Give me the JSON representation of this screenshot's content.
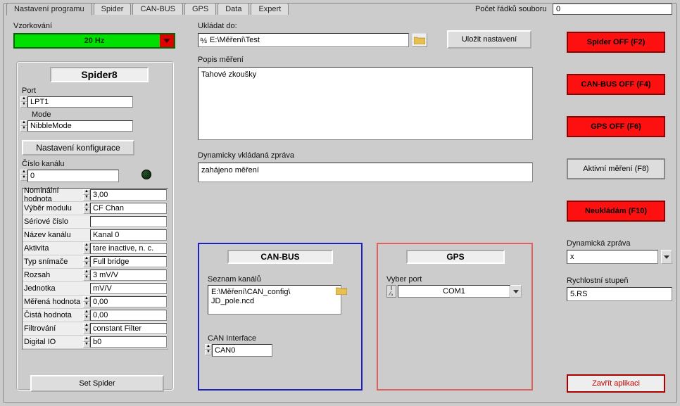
{
  "tabs": [
    "Nastavení programu",
    "Spider",
    "CAN-BUS",
    "GPS",
    "Data",
    "Expert"
  ],
  "active_tab_index": 0,
  "row_count_label": "Počet řádků souboru",
  "row_count_value": "0",
  "vzork": {
    "label": "Vzorkování",
    "value": "20 Hz"
  },
  "spider": {
    "title": "Spider8",
    "port_label": "Port",
    "port_value": "LPT1",
    "mode_label": "Mode",
    "mode_value": "NibbleMode",
    "config_btn": "Nastavení konfigurace",
    "channel_num_label": "Číslo kanálu",
    "channel_num_value": "0",
    "rows": [
      {
        "label": "Nominální hodnota",
        "value": "3,00",
        "spin": true
      },
      {
        "label": "Výběr modulu",
        "value": "CF Chan",
        "spin": true
      },
      {
        "label": "Sériové číslo",
        "value": "",
        "spin": false
      },
      {
        "label": "Název kanálu",
        "value": "Kanal 0",
        "spin": false
      },
      {
        "label": "Aktivita",
        "value": "tare inactive, n. c.",
        "spin": true
      },
      {
        "label": "Typ snímače",
        "value": "Full bridge",
        "spin": true
      },
      {
        "label": "Rozsah",
        "value": "3 mV/V",
        "spin": true
      },
      {
        "label": "Jednotka",
        "value": "mV/V",
        "spin": false
      },
      {
        "label": "Měřená hodnota",
        "value": "0,00",
        "spin": true
      },
      {
        "label": "Čistá hodnota",
        "value": "0,00",
        "spin": true
      },
      {
        "label": "Filtrování",
        "value": "constant Filter",
        "spin": true
      },
      {
        "label": "Digital IO",
        "value": "b0",
        "spin": true
      }
    ],
    "set_btn": "Set Spider"
  },
  "save": {
    "label": "Ukládat do:",
    "path": "E:\\Měření\\Test",
    "btn": "Uložit nastavení"
  },
  "popis": {
    "label": "Popis měření",
    "value": "Tahové zkoušky"
  },
  "dyn": {
    "label": "Dynamicky vkládaná zpráva",
    "value": "zahájeno měření"
  },
  "can": {
    "title": "CAN-BUS",
    "list_label": "Seznam kanálů",
    "list_value": "E:\\Měření\\CAN_config\\\nJD_pole.ncd",
    "iface_label": "CAN Interface",
    "iface_value": "CAN0"
  },
  "gps": {
    "title": "GPS",
    "port_label": "Vyber port",
    "port_value": "COM1"
  },
  "rbuttons": {
    "spider": "Spider OFF (F2)",
    "canbus": "CAN-BUS OFF (F4)",
    "gps": "GPS OFF (F6)",
    "active": "Aktivní měření (F8)",
    "nosave": "Neukládám  (F10)"
  },
  "dz": {
    "label": "Dynamická zpráva",
    "value": "x"
  },
  "rs": {
    "label": "Rychlostní stupeň",
    "value": "5.RS"
  },
  "close_btn": "Zavřít aplikaci"
}
